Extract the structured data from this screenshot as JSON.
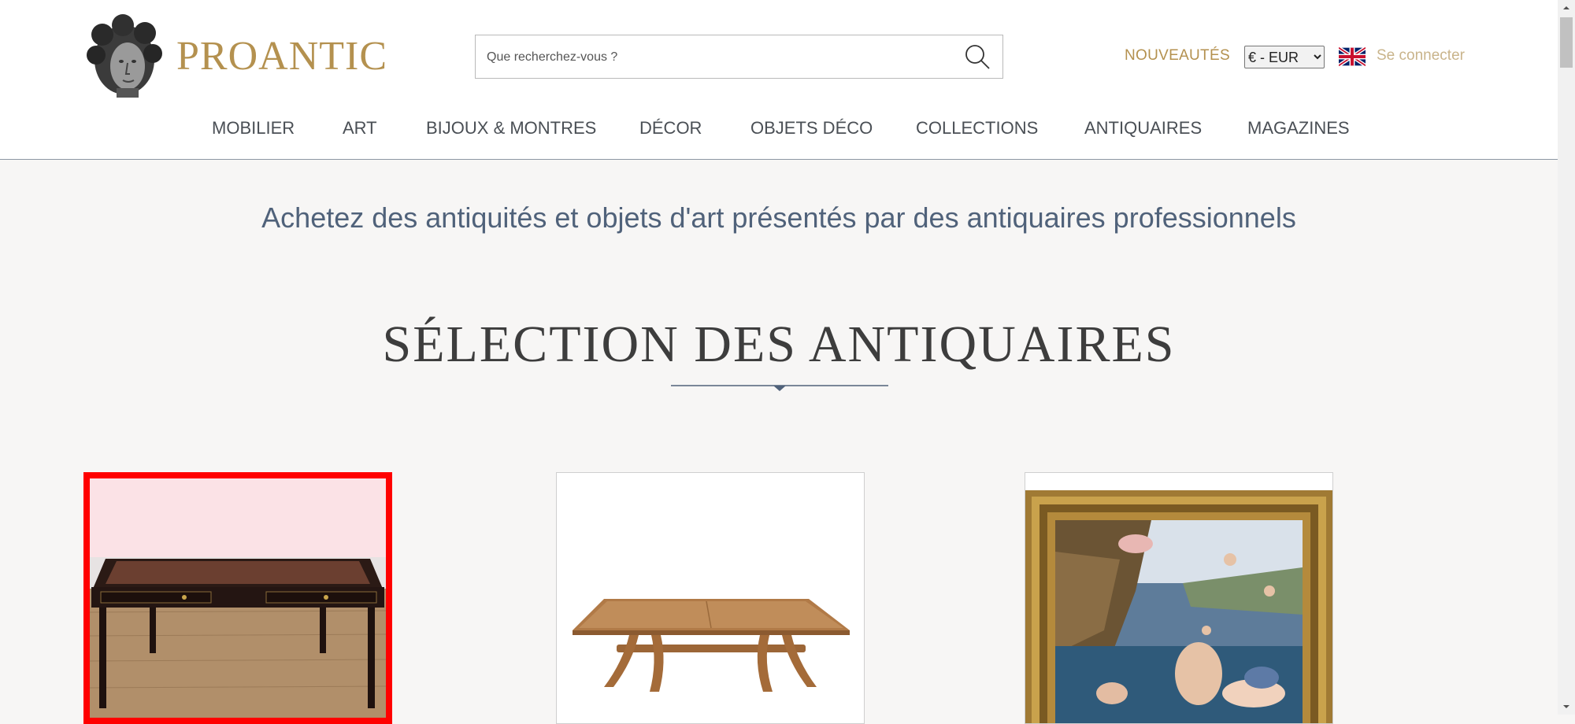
{
  "header": {
    "brand": "PROANTIC",
    "search_placeholder": "Que recherchez-vous ?",
    "nouveautes": "NOUVEAUTÉS",
    "currency": "€ - EUR",
    "login": "Se connecter"
  },
  "nav": {
    "items": [
      "MOBILIER",
      "ART",
      "BIJOUX & MONTRES",
      "DÉCOR",
      "OBJETS DÉCO",
      "COLLECTIONS",
      "ANTIQUAIRES",
      "MAGAZINES"
    ]
  },
  "main": {
    "tagline": "Achetez des antiquités et objets d'art présentés par des antiquaires professionnels",
    "section_title": "SÉLECTION DES ANTIQUAIRES"
  },
  "colors": {
    "gold": "#b4914f",
    "login": "#c9b48b",
    "tagline": "#50627a",
    "selection_border": "#ff0000"
  },
  "cards": [
    {
      "image": "mahogany-leather-top-desk",
      "selected": true
    },
    {
      "image": "wooden-dining-table",
      "selected": false
    },
    {
      "image": "gilt-framed-mythological-painting",
      "selected": false
    }
  ]
}
